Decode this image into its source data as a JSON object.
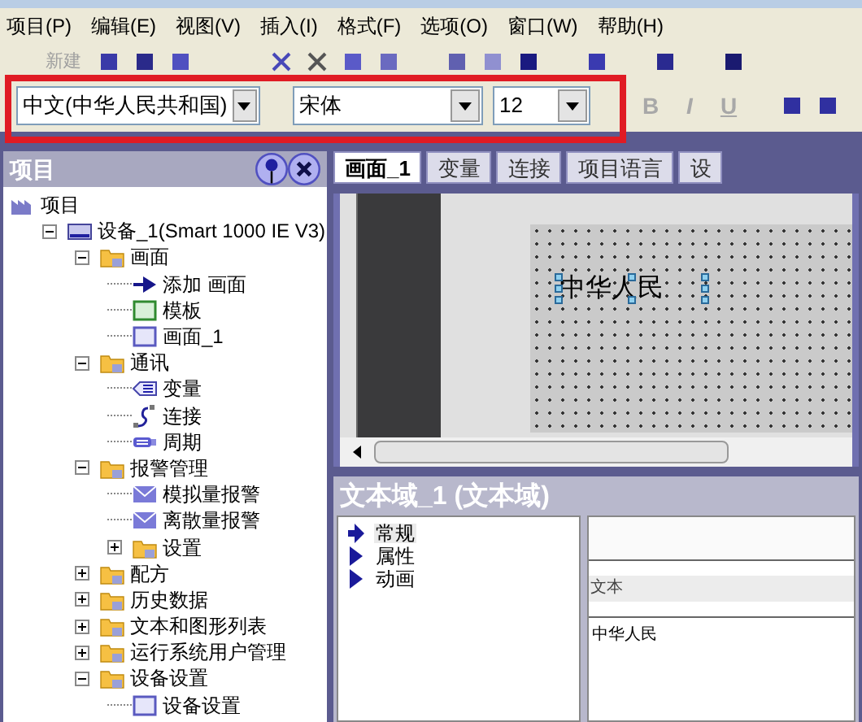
{
  "menu": [
    "项目(P)",
    "编辑(E)",
    "视图(V)",
    "插入(I)",
    "格式(F)",
    "选项(O)",
    "窗口(W)",
    "帮助(H)"
  ],
  "toolbar": {
    "new_label": "新建",
    "new_disabled": true
  },
  "format_bar": {
    "language": "中文(中华人民共和国)",
    "font": "宋体",
    "size": "12",
    "styles": [
      {
        "label": "B",
        "disabled": true
      },
      {
        "label": "I",
        "disabled": true
      },
      {
        "label": "U",
        "disabled": true
      }
    ]
  },
  "project_panel": {
    "title": "项目",
    "tree": [
      {
        "label": "项目",
        "kind": "project",
        "children": [
          {
            "label": "设备_1(Smart 1000 IE V3)",
            "kind": "device",
            "expanded": true,
            "children": [
              {
                "label": "画面",
                "kind": "folder",
                "expanded": true,
                "children": [
                  {
                    "label": "添加 画面",
                    "kind": "add"
                  },
                  {
                    "label": "模板",
                    "kind": "template"
                  },
                  {
                    "label": "画面_1",
                    "kind": "screen"
                  }
                ]
              },
              {
                "label": "通讯",
                "kind": "folder",
                "expanded": true,
                "children": [
                  {
                    "label": "变量",
                    "kind": "tags"
                  },
                  {
                    "label": "连接",
                    "kind": "connection"
                  },
                  {
                    "label": "周期",
                    "kind": "cycle"
                  }
                ]
              },
              {
                "label": "报警管理",
                "kind": "folder",
                "expanded": true,
                "children": [
                  {
                    "label": "模拟量报警",
                    "kind": "alarm"
                  },
                  {
                    "label": "离散量报警",
                    "kind": "alarm"
                  },
                  {
                    "label": "设置",
                    "kind": "folder",
                    "expanded": false
                  }
                ]
              },
              {
                "label": "配方",
                "kind": "folder",
                "expanded": false
              },
              {
                "label": "历史数据",
                "kind": "folder",
                "expanded": false
              },
              {
                "label": "文本和图形列表",
                "kind": "folder",
                "expanded": false
              },
              {
                "label": "运行系统用户管理",
                "kind": "folder",
                "expanded": false
              },
              {
                "label": "设备设置",
                "kind": "folder",
                "expanded": true,
                "children": [
                  {
                    "label": "设备设置",
                    "kind": "screen"
                  }
                ]
              }
            ]
          }
        ]
      }
    ]
  },
  "tabs": [
    {
      "label": "画面_1",
      "selected": true
    },
    {
      "label": "变量",
      "selected": false
    },
    {
      "label": "连接",
      "selected": false
    },
    {
      "label": "项目语言",
      "selected": false
    },
    {
      "label": "设",
      "selected": false
    }
  ],
  "canvas": {
    "text_field": "中华人民"
  },
  "properties": {
    "title": "文本域_1 (文本域)",
    "groups": [
      {
        "label": "常规",
        "selected": true
      },
      {
        "label": "属性",
        "selected": false
      },
      {
        "label": "动画",
        "selected": false
      }
    ],
    "column": "文本",
    "value": "中华人民"
  }
}
